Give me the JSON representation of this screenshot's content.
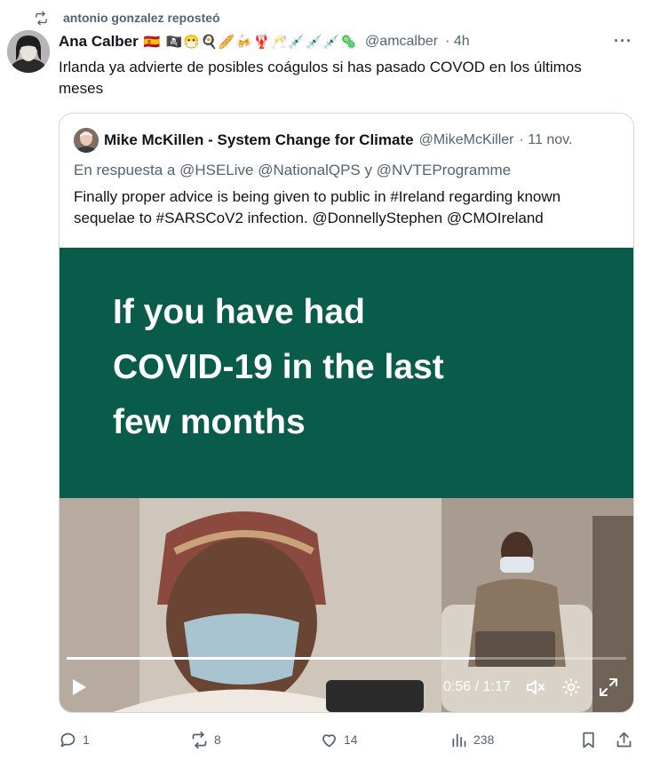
{
  "repost": {
    "label": "antonio gonzalez reposteó"
  },
  "tweet": {
    "author_name": "Ana Calber",
    "author_emojis": "🇪🇸 🏴‍☠️😷🍳🥖🍻🦞🥂💉💉💉🦠",
    "handle": "@amcalber",
    "time": "· 4h",
    "more": "···",
    "text": "Irlanda ya advierte de posibles coágulos si has pasado COVOD en los últimos meses"
  },
  "quote": {
    "author_name": "Mike McKillen - System Change for Climate",
    "handle": "@MikeMcKiller",
    "time": "· 11 nov.",
    "reply_prefix": "En respuesta a",
    "reply_to": [
      "@HSELive",
      "@NationalQPS",
      "@NVTEProgramme"
    ],
    "reply_connector": "y",
    "text": "Finally proper advice is being given to public in #Ireland regarding known sequelae to #SARSCoV2 infection. @DonnellyStephen @CMOIreland",
    "video": {
      "headline_lines": [
        "If you have had",
        "COVID-19 in the last",
        "few months"
      ],
      "time_display": "0:56 / 1:17",
      "progress": 0.73
    }
  },
  "actions": {
    "replies": "1",
    "reposts": "8",
    "likes": "14",
    "views": "238"
  },
  "colors": {
    "green_panel": "#0a5c4a",
    "secondary_text": "#536471",
    "border": "#cfd9de"
  }
}
